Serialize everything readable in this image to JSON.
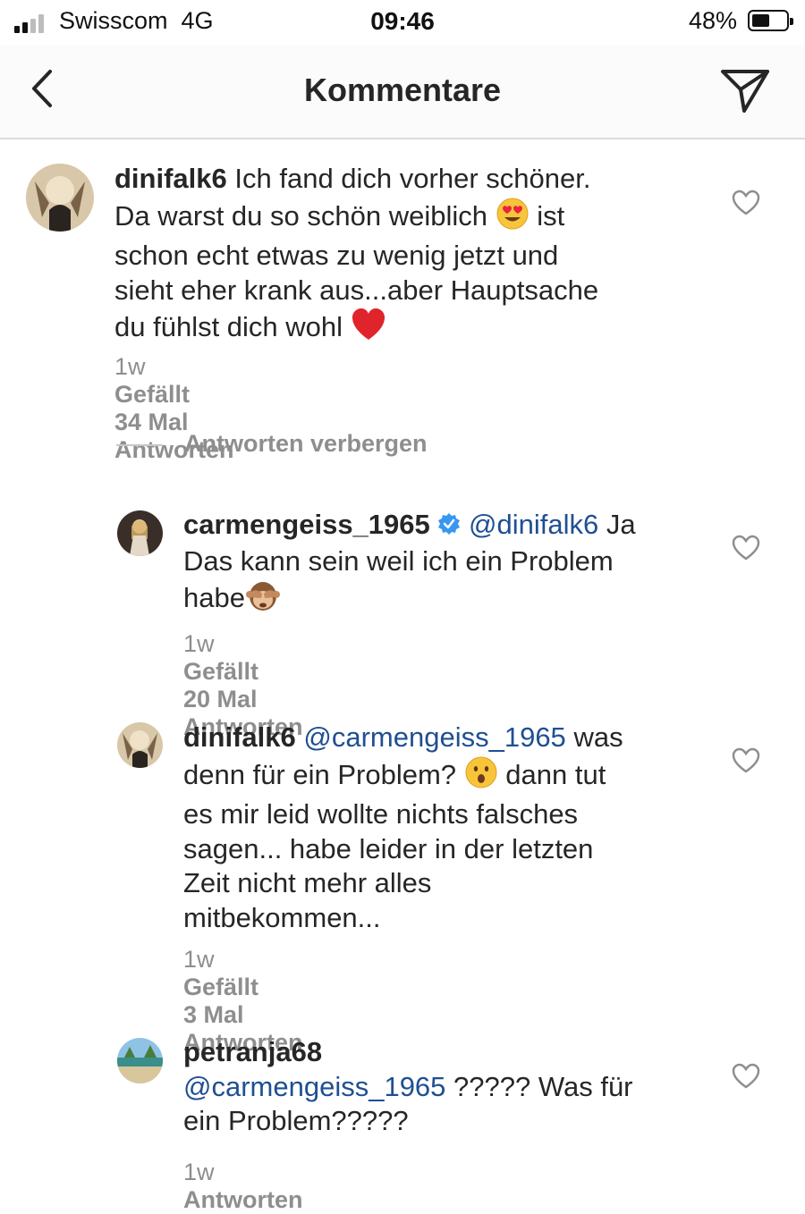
{
  "status_bar": {
    "carrier": "Swisscom",
    "network": "4G",
    "time": "09:46",
    "battery_percent": "48%",
    "battery_level": 0.48,
    "signal_bars": 2
  },
  "nav": {
    "title": "Kommentare",
    "back_icon": "chevron-left-icon",
    "send_icon": "paper-plane-icon"
  },
  "comments": [
    {
      "username": "dinifalk6",
      "text_1": "Ich fand dich vorher schöner.",
      "text_2": "Da warst du so schön weiblich",
      "text_3": "ist",
      "text_4": "schon echt etwas zu wenig jetzt und",
      "text_5": "sieht eher krank aus...aber Hauptsache",
      "text_6": "du fühlst dich wohl",
      "time": "1w",
      "likes": "Gefällt 34 Mal",
      "reply": "Antworten"
    },
    {
      "username": "carmengeiss_1965",
      "mention": "@dinifalk6",
      "text_1": "Ja",
      "text_2": "Das kann sein weil ich ein Problem",
      "text_3": "habe",
      "time": "1w",
      "likes": "Gefällt 20 Mal",
      "reply": "Antworten"
    },
    {
      "username": "dinifalk6",
      "mention": "@carmengeiss_1965",
      "text_1": "was",
      "text_2": "denn für ein Problem?",
      "text_3": "dann tut",
      "text_4": "es mir leid wollte nichts falsches",
      "text_5": "sagen... habe leider in der letzten",
      "text_6": "Zeit nicht mehr alles",
      "text_7": "mitbekommen...",
      "time": "1w",
      "likes": "Gefällt 3 Mal",
      "reply": "Antworten"
    },
    {
      "username": "petranja68",
      "mention": "@carmengeiss_1965",
      "text_1": "????? Was für",
      "text_2": "ein Problem?????",
      "time": "1w",
      "reply": "Antworten"
    }
  ],
  "hide_replies_label": "Antworten verbergen",
  "colors": {
    "mention": "#1f4f93",
    "meta": "#8e8e8e",
    "verified": "#3897f0",
    "heart_red": "#e0242b"
  }
}
